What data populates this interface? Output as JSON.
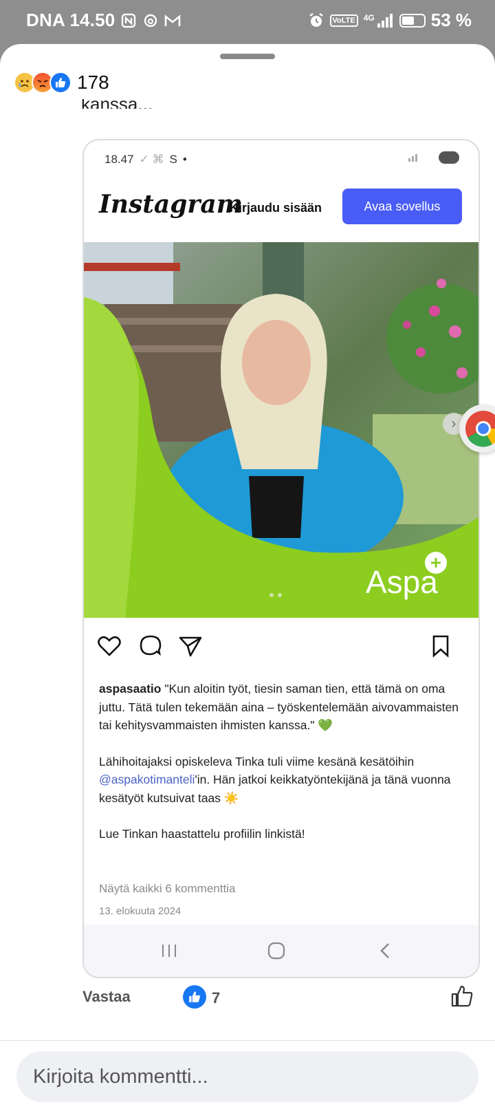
{
  "status_bar": {
    "carrier_time": "DNA 14.50",
    "network": "4G",
    "volte": "VoLTE",
    "battery": "53 %"
  },
  "post": {
    "reaction_count": "178",
    "cut_text": "kanssa..."
  },
  "embedded": {
    "status_time": "18.47",
    "status_s": "S",
    "instagram_logo": "Instagram",
    "login_label": "Kirjaudu sisään",
    "open_app_label": "Avaa sovellus",
    "brand_logo": "Aspa",
    "caption": {
      "username": "aspasaatio",
      "paragraph1": " \"Kun aloitin työt, tiesin saman tien, että tämä on oma juttu. Tätä tulen tekemään aina – työskentelemään aivovammaisten tai kehitysvammaisten ihmisten kanssa.\" 💚",
      "paragraph2_start": "Lähihoitajaksi opiskeleva Tinka tuli viime kesänä kesätöihin ",
      "mention": "@aspakotimanteli",
      "paragraph2_end": "'in. Hän jatkoi keikkatyöntekijänä ja tänä vuonna kesätyöt kutsuivat taas ☀️",
      "paragraph3": "Lue Tinkan haastattelu profiilin linkistä!"
    },
    "view_all_comments": "Näytä kaikki 6 kommenttia",
    "date": "13. elokuuta 2024"
  },
  "comment_actions": {
    "reply_label": "Vastaa",
    "like_count": "7"
  },
  "comment_input": {
    "placeholder": "Kirjoita kommentti..."
  },
  "colors": {
    "instagram_button": "#4a5cf6",
    "facebook_blue": "#1877f2",
    "aspa_green": "#8ccd20"
  }
}
